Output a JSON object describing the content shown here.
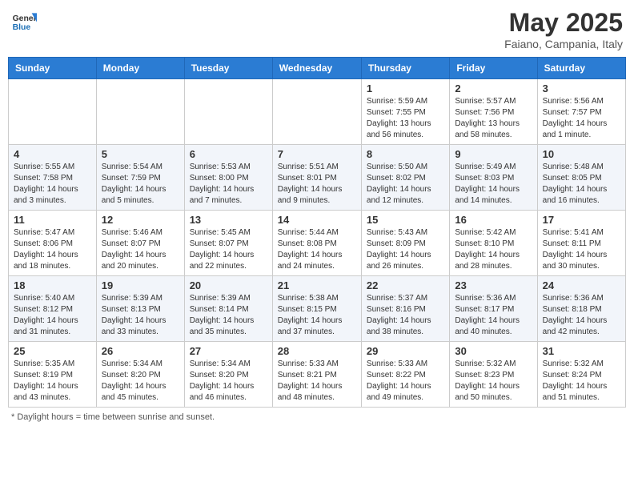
{
  "header": {
    "logo_general": "General",
    "logo_blue": "Blue",
    "month_title": "May 2025",
    "location": "Faiano, Campania, Italy"
  },
  "footer": {
    "note": "Daylight hours"
  },
  "days_of_week": [
    "Sunday",
    "Monday",
    "Tuesday",
    "Wednesday",
    "Thursday",
    "Friday",
    "Saturday"
  ],
  "weeks": [
    [
      {
        "day": "",
        "info": ""
      },
      {
        "day": "",
        "info": ""
      },
      {
        "day": "",
        "info": ""
      },
      {
        "day": "",
        "info": ""
      },
      {
        "day": "1",
        "info": "Sunrise: 5:59 AM\nSunset: 7:55 PM\nDaylight: 13 hours\nand 56 minutes."
      },
      {
        "day": "2",
        "info": "Sunrise: 5:57 AM\nSunset: 7:56 PM\nDaylight: 13 hours\nand 58 minutes."
      },
      {
        "day": "3",
        "info": "Sunrise: 5:56 AM\nSunset: 7:57 PM\nDaylight: 14 hours\nand 1 minute."
      }
    ],
    [
      {
        "day": "4",
        "info": "Sunrise: 5:55 AM\nSunset: 7:58 PM\nDaylight: 14 hours\nand 3 minutes."
      },
      {
        "day": "5",
        "info": "Sunrise: 5:54 AM\nSunset: 7:59 PM\nDaylight: 14 hours\nand 5 minutes."
      },
      {
        "day": "6",
        "info": "Sunrise: 5:53 AM\nSunset: 8:00 PM\nDaylight: 14 hours\nand 7 minutes."
      },
      {
        "day": "7",
        "info": "Sunrise: 5:51 AM\nSunset: 8:01 PM\nDaylight: 14 hours\nand 9 minutes."
      },
      {
        "day": "8",
        "info": "Sunrise: 5:50 AM\nSunset: 8:02 PM\nDaylight: 14 hours\nand 12 minutes."
      },
      {
        "day": "9",
        "info": "Sunrise: 5:49 AM\nSunset: 8:03 PM\nDaylight: 14 hours\nand 14 minutes."
      },
      {
        "day": "10",
        "info": "Sunrise: 5:48 AM\nSunset: 8:05 PM\nDaylight: 14 hours\nand 16 minutes."
      }
    ],
    [
      {
        "day": "11",
        "info": "Sunrise: 5:47 AM\nSunset: 8:06 PM\nDaylight: 14 hours\nand 18 minutes."
      },
      {
        "day": "12",
        "info": "Sunrise: 5:46 AM\nSunset: 8:07 PM\nDaylight: 14 hours\nand 20 minutes."
      },
      {
        "day": "13",
        "info": "Sunrise: 5:45 AM\nSunset: 8:07 PM\nDaylight: 14 hours\nand 22 minutes."
      },
      {
        "day": "14",
        "info": "Sunrise: 5:44 AM\nSunset: 8:08 PM\nDaylight: 14 hours\nand 24 minutes."
      },
      {
        "day": "15",
        "info": "Sunrise: 5:43 AM\nSunset: 8:09 PM\nDaylight: 14 hours\nand 26 minutes."
      },
      {
        "day": "16",
        "info": "Sunrise: 5:42 AM\nSunset: 8:10 PM\nDaylight: 14 hours\nand 28 minutes."
      },
      {
        "day": "17",
        "info": "Sunrise: 5:41 AM\nSunset: 8:11 PM\nDaylight: 14 hours\nand 30 minutes."
      }
    ],
    [
      {
        "day": "18",
        "info": "Sunrise: 5:40 AM\nSunset: 8:12 PM\nDaylight: 14 hours\nand 31 minutes."
      },
      {
        "day": "19",
        "info": "Sunrise: 5:39 AM\nSunset: 8:13 PM\nDaylight: 14 hours\nand 33 minutes."
      },
      {
        "day": "20",
        "info": "Sunrise: 5:39 AM\nSunset: 8:14 PM\nDaylight: 14 hours\nand 35 minutes."
      },
      {
        "day": "21",
        "info": "Sunrise: 5:38 AM\nSunset: 8:15 PM\nDaylight: 14 hours\nand 37 minutes."
      },
      {
        "day": "22",
        "info": "Sunrise: 5:37 AM\nSunset: 8:16 PM\nDaylight: 14 hours\nand 38 minutes."
      },
      {
        "day": "23",
        "info": "Sunrise: 5:36 AM\nSunset: 8:17 PM\nDaylight: 14 hours\nand 40 minutes."
      },
      {
        "day": "24",
        "info": "Sunrise: 5:36 AM\nSunset: 8:18 PM\nDaylight: 14 hours\nand 42 minutes."
      }
    ],
    [
      {
        "day": "25",
        "info": "Sunrise: 5:35 AM\nSunset: 8:19 PM\nDaylight: 14 hours\nand 43 minutes."
      },
      {
        "day": "26",
        "info": "Sunrise: 5:34 AM\nSunset: 8:20 PM\nDaylight: 14 hours\nand 45 minutes."
      },
      {
        "day": "27",
        "info": "Sunrise: 5:34 AM\nSunset: 8:20 PM\nDaylight: 14 hours\nand 46 minutes."
      },
      {
        "day": "28",
        "info": "Sunrise: 5:33 AM\nSunset: 8:21 PM\nDaylight: 14 hours\nand 48 minutes."
      },
      {
        "day": "29",
        "info": "Sunrise: 5:33 AM\nSunset: 8:22 PM\nDaylight: 14 hours\nand 49 minutes."
      },
      {
        "day": "30",
        "info": "Sunrise: 5:32 AM\nSunset: 8:23 PM\nDaylight: 14 hours\nand 50 minutes."
      },
      {
        "day": "31",
        "info": "Sunrise: 5:32 AM\nSunset: 8:24 PM\nDaylight: 14 hours\nand 51 minutes."
      }
    ]
  ]
}
